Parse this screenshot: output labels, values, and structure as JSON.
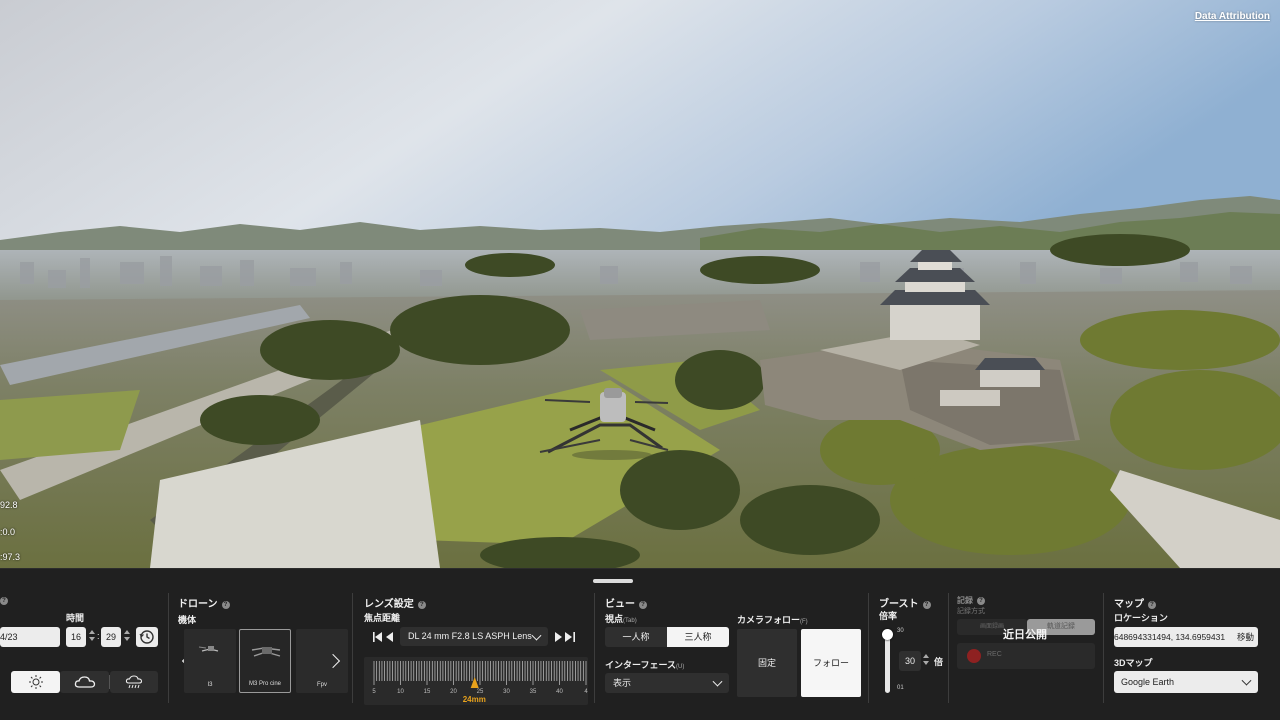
{
  "viewport": {
    "attribution": "Data Attribution",
    "telemetry": [
      "92.8",
      "0.0",
      "97.3"
    ],
    "telemetry_prefix": [
      "",
      ":",
      ":"
    ]
  },
  "weather": {
    "date": "4/23",
    "time_label": "時間",
    "hour": "16",
    "minute": "29",
    "colon": ":",
    "options": [
      "sunny",
      "cloudy",
      "rainy"
    ],
    "selected": "sunny"
  },
  "drone": {
    "title": "ドローン",
    "model_label": "機体",
    "models": [
      "I3",
      "M3 Pro cine",
      "Fpv"
    ],
    "selected": "M3 Pro cine"
  },
  "lens": {
    "title": "レンズ設定",
    "focal_label": "焦点距離",
    "lens_name": "DL 24 mm F2.8 LS ASPH Lens",
    "ruler_ticks": [
      "5",
      "10",
      "15",
      "20",
      "25",
      "30",
      "35",
      "40",
      "4"
    ],
    "current_focal": "24mm",
    "current_value": 24
  },
  "view": {
    "title": "ビュー",
    "viewpoint_label": "視点",
    "viewpoint_hint": "(Tab)",
    "first_person": "一人称",
    "third_person": "三人称",
    "selected_view": "三人称",
    "camera_follow_label": "カメラフォロー",
    "camera_follow_hint": "(F)",
    "fixed": "固定",
    "follow": "フォロー",
    "selected_follow": "フォロー",
    "interface_label": "インターフェース",
    "interface_hint": "(U)",
    "interface_value": "表示"
  },
  "boost": {
    "title": "ブースト",
    "multiplier_label": "倍率",
    "max": "30",
    "min": "01",
    "value": "30",
    "unit": "倍",
    "level": 1.0
  },
  "record": {
    "title": "記録",
    "mode_label": "記録方式",
    "mode_screen": "画面録画",
    "mode_track": "軌道記録",
    "coming_soon": "近日公開",
    "rec": "REC"
  },
  "map": {
    "title": "マップ",
    "location_label": "ロケーション",
    "location_value": "648694331494, 134.6959431",
    "move_label": "移動",
    "map3d_label": "3Dマップ",
    "map3d_value": "Google Earth"
  },
  "colors": {
    "panel_bg": "#202020",
    "control_light": "#ececec",
    "control_dark": "#2f2f2f",
    "accent_orange": "#e8a21c",
    "rec_red": "#c42828"
  }
}
